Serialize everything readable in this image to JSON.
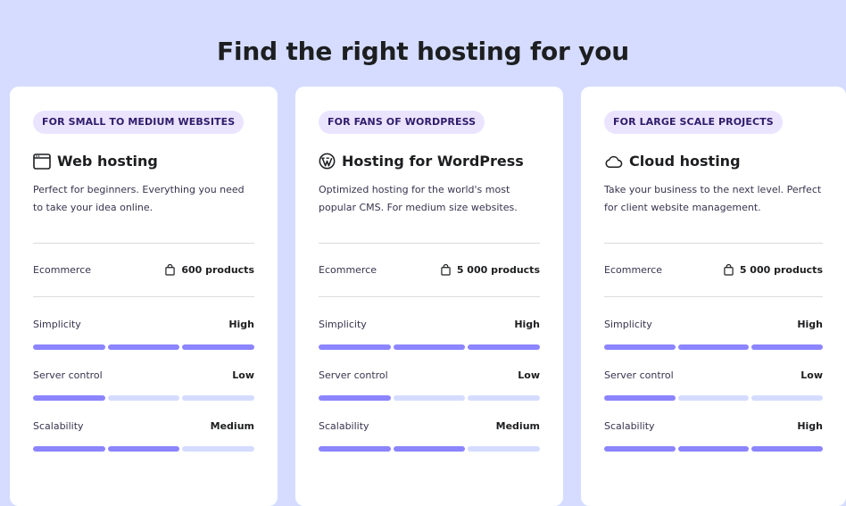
{
  "page_title": "Find the right hosting for you",
  "cards": [
    {
      "badge": "FOR SMALL TO MEDIUM WEBSITES",
      "icon": "browser-window-icon",
      "title": "Web hosting",
      "description": "Perfect for beginners. Everything you need to take your idea online.",
      "ecommerce_label": "Ecommerce",
      "ecommerce_value": "600 products",
      "metrics": [
        {
          "label": "Simplicity",
          "value": "High",
          "level": 3
        },
        {
          "label": "Server control",
          "value": "Low",
          "level": 1
        },
        {
          "label": "Scalability",
          "value": "Medium",
          "level": 2
        }
      ]
    },
    {
      "badge": "FOR FANS OF WORDPRESS",
      "icon": "wordpress-icon",
      "title": "Hosting for WordPress",
      "description": "Optimized hosting for the world's most popular CMS. For medium size websites.",
      "ecommerce_label": "Ecommerce",
      "ecommerce_value": "5 000 products",
      "metrics": [
        {
          "label": "Simplicity",
          "value": "High",
          "level": 3
        },
        {
          "label": "Server control",
          "value": "Low",
          "level": 1
        },
        {
          "label": "Scalability",
          "value": "Medium",
          "level": 2
        }
      ]
    },
    {
      "badge": "FOR LARGE SCALE PROJECTS",
      "icon": "cloud-icon",
      "title": "Cloud hosting",
      "description": "Take your business to the next level. Perfect for client website management.",
      "ecommerce_label": "Ecommerce",
      "ecommerce_value": "5 000 products",
      "metrics": [
        {
          "label": "Simplicity",
          "value": "High",
          "level": 3
        },
        {
          "label": "Server control",
          "value": "Low",
          "level": 1
        },
        {
          "label": "Scalability",
          "value": "High",
          "level": 3
        }
      ]
    }
  ],
  "colors": {
    "background": "#d5dcff",
    "bar_active": "#8c85ff",
    "bar_inactive": "#d5dcff",
    "badge_bg": "#ebe4ff"
  }
}
